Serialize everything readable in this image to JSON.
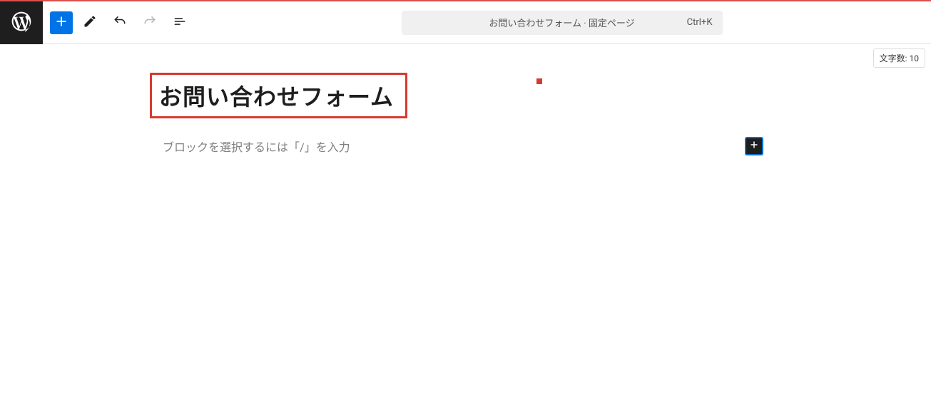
{
  "toolbar": {
    "command_hint": "お問い合わせフォーム · 固定ページ",
    "command_shortcut": "Ctrl+K"
  },
  "meta": {
    "char_count_label": "文字数:",
    "char_count_value": "10"
  },
  "editor": {
    "title": "お問い合わせフォーム",
    "block_placeholder": "ブロックを選択するには「/」を入力"
  }
}
